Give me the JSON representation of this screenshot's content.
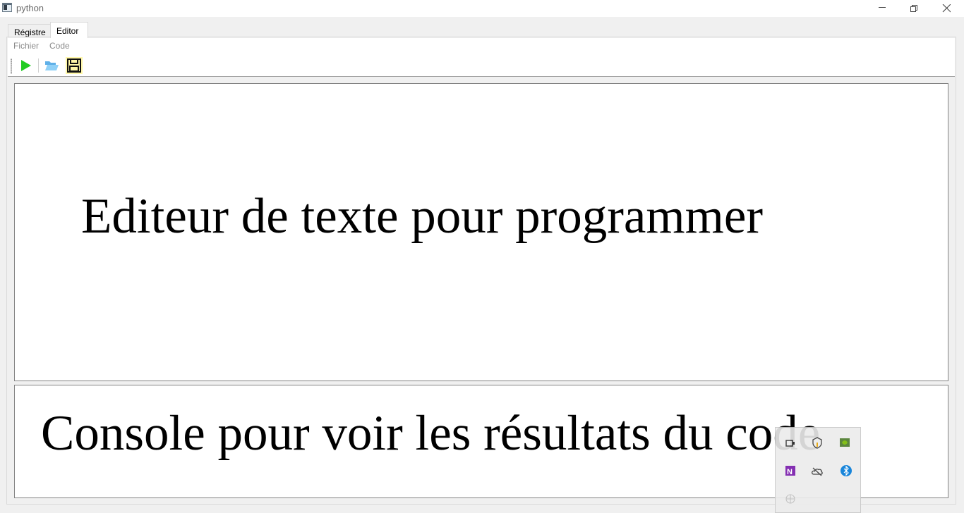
{
  "window": {
    "title": "python"
  },
  "tabs": [
    {
      "label": "Régistre",
      "active": false
    },
    {
      "label": "Editor",
      "active": true
    }
  ],
  "menu": {
    "items": [
      "Fichier",
      "Code"
    ]
  },
  "toolbar": {
    "buttons": [
      "play-icon",
      "open-folder-icon",
      "save-icon"
    ]
  },
  "editor": {
    "text": "Editeur de texte pour programmer"
  },
  "console": {
    "text": "Console pour voir les résultats du code"
  },
  "tray": {
    "icons": [
      "windows-security-icon",
      "shield-warning-icon",
      "nvidia-icon",
      "onenote-icon",
      "onedrive-offline-icon",
      "bluetooth-icon",
      "network-icon"
    ]
  },
  "colors": {
    "play": "#22cc22",
    "folder": "#7ec8f2",
    "save_highlight": "#fff7a8",
    "onenote": "#7719aa",
    "bluetooth": "#0078d7"
  }
}
